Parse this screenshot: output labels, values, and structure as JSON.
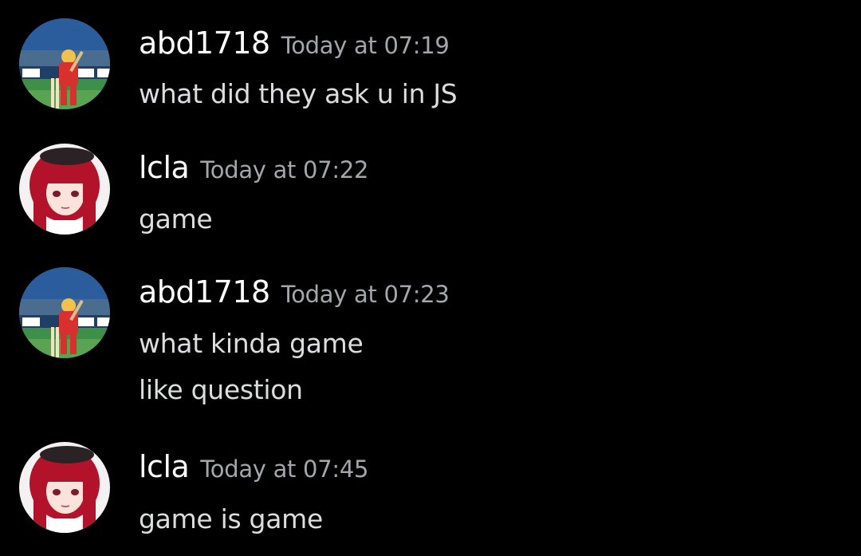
{
  "messages": [
    {
      "author": "abd1718",
      "avatar_icon": "cricket-player-avatar-icon",
      "timestamp": "Today at 07:19",
      "lines": [
        "what did they ask u in JS"
      ]
    },
    {
      "author": "lcla",
      "avatar_icon": "anime-girl-avatar-icon",
      "timestamp": "Today at 07:22",
      "lines": [
        "game"
      ]
    },
    {
      "author": "abd1718",
      "avatar_icon": "cricket-player-avatar-icon",
      "timestamp": "Today at 07:23",
      "lines": [
        "what kinda game",
        "like question"
      ]
    },
    {
      "author": "lcla",
      "avatar_icon": "anime-girl-avatar-icon",
      "timestamp": "Today at 07:45",
      "lines": [
        "game is game"
      ]
    }
  ],
  "colors": {
    "background": "#000000",
    "username": "#ffffff",
    "timestamp": "#a3a6aa",
    "message_text": "#dcddde"
  }
}
